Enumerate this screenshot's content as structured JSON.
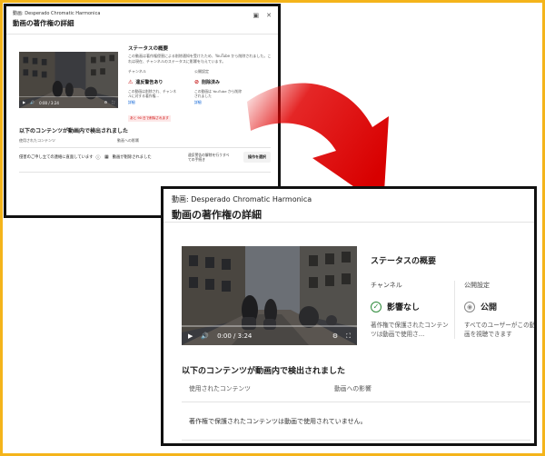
{
  "colors": {
    "background": "#f4b41a",
    "arrow": "#e00000",
    "check": "#2e8b3a",
    "link": "#065fd4",
    "warning": "#c00000"
  },
  "small_panel": {
    "video_label": "動画: Desperado Chromatic Harmonica",
    "title": "動画の著作権の詳細",
    "header_icons": [
      "feedback-icon",
      "close-icon"
    ],
    "player": {
      "time": "0:00 / 3:24"
    },
    "status": {
      "title": "ステータスの概要",
      "description": "この動画は著作権侵害による削除通知を受けたため、YouTube から削除されました。これは現在、チャンネルのステータスに影響を与えています。",
      "channel": {
        "heading": "チャンネル",
        "value": "違反警告あり",
        "description": "この動画は削除され、チャンネルに対する著作権…",
        "link": "詳細"
      },
      "visibility": {
        "heading": "公開設定",
        "value": "削除済み",
        "description": "この動画は YouTube から削除されました",
        "link": "詳細"
      },
      "warning_badge": "あと 90 日で削除されます"
    },
    "detected_title": "以下のコンテンツが動画内で検出されました",
    "table_headers": [
      "使用されたコンテンツ",
      "動画への影響"
    ],
    "row": {
      "content": "侵害のご申し立ての連絡に直面しています",
      "impact": "動画が削除されました",
      "action_note": "違反警告の解除を行うすべての手続き",
      "button": "操作を選択"
    }
  },
  "large_panel": {
    "video_label": "動画: Desperado Chromatic Harmonica",
    "title": "動画の著作権の詳細",
    "player": {
      "time": "0:00 / 3:24"
    },
    "status": {
      "title": "ステータスの概要",
      "channel": {
        "heading": "チャンネル",
        "value": "影響なし",
        "description": "著作権で保護されたコンテンツは動画で使用さ…"
      },
      "visibility": {
        "heading": "公開設定",
        "value": "公開",
        "description": "すべてのユーザーがこの動画を視聴できます"
      }
    },
    "detected_title": "以下のコンテンツが動画内で検出されました",
    "table_headers": [
      "使用されたコンテンツ",
      "動画への影響"
    ],
    "empty_message": "著作権で保護されたコンテンツは動画で使用されていません。"
  }
}
